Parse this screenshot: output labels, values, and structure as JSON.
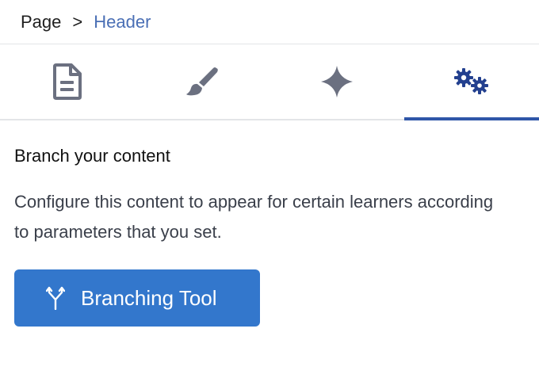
{
  "breadcrumb": {
    "parent": "Page",
    "separator": ">",
    "current": "Header"
  },
  "tabs": [
    {
      "icon": "document-icon",
      "active": false
    },
    {
      "icon": "brush-icon",
      "active": false
    },
    {
      "icon": "sparkle-icon",
      "active": false
    },
    {
      "icon": "gears-icon",
      "active": true
    }
  ],
  "colors": {
    "accent": "#2f56a8",
    "breadcrumb_current": "#4a6fb5",
    "button_bg": "#3377cc",
    "icon_gray": "#6b7080"
  },
  "section": {
    "title": "Branch your content",
    "description": "Configure this content to appear for certain learners according to parameters that you set.",
    "button_label": "Branching Tool",
    "button_icon": "branch-icon"
  }
}
